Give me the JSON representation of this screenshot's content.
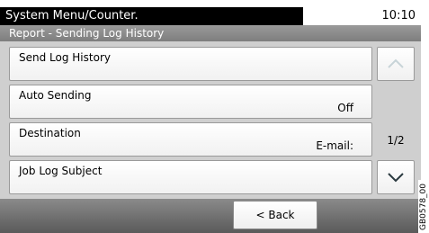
{
  "header": {
    "path": "System Menu/Counter.",
    "time": "10:10",
    "title": "Report - Sending Log History"
  },
  "items": [
    {
      "label": "Send Log History",
      "value": ""
    },
    {
      "label": "Auto Sending",
      "value": "Off"
    },
    {
      "label": "Destination",
      "value": "E-mail:"
    },
    {
      "label": "Job Log Subject",
      "value": ""
    }
  ],
  "scroll": {
    "page": "1/2",
    "up_icon": "chevron-up-icon",
    "down_icon": "chevron-down-icon",
    "up_enabled": false,
    "down_enabled": true
  },
  "footer": {
    "back_label": "< Back"
  },
  "figure_code": "GB0578_00",
  "colors": {
    "path_bar": "#000000",
    "title_bar": "#8a8a8a",
    "panel": "#cfcfcf",
    "bottom_bar": "#6e6e6e",
    "disabled_arrow": "#c8d4d8",
    "enabled_arrow": "#2b3a40"
  }
}
